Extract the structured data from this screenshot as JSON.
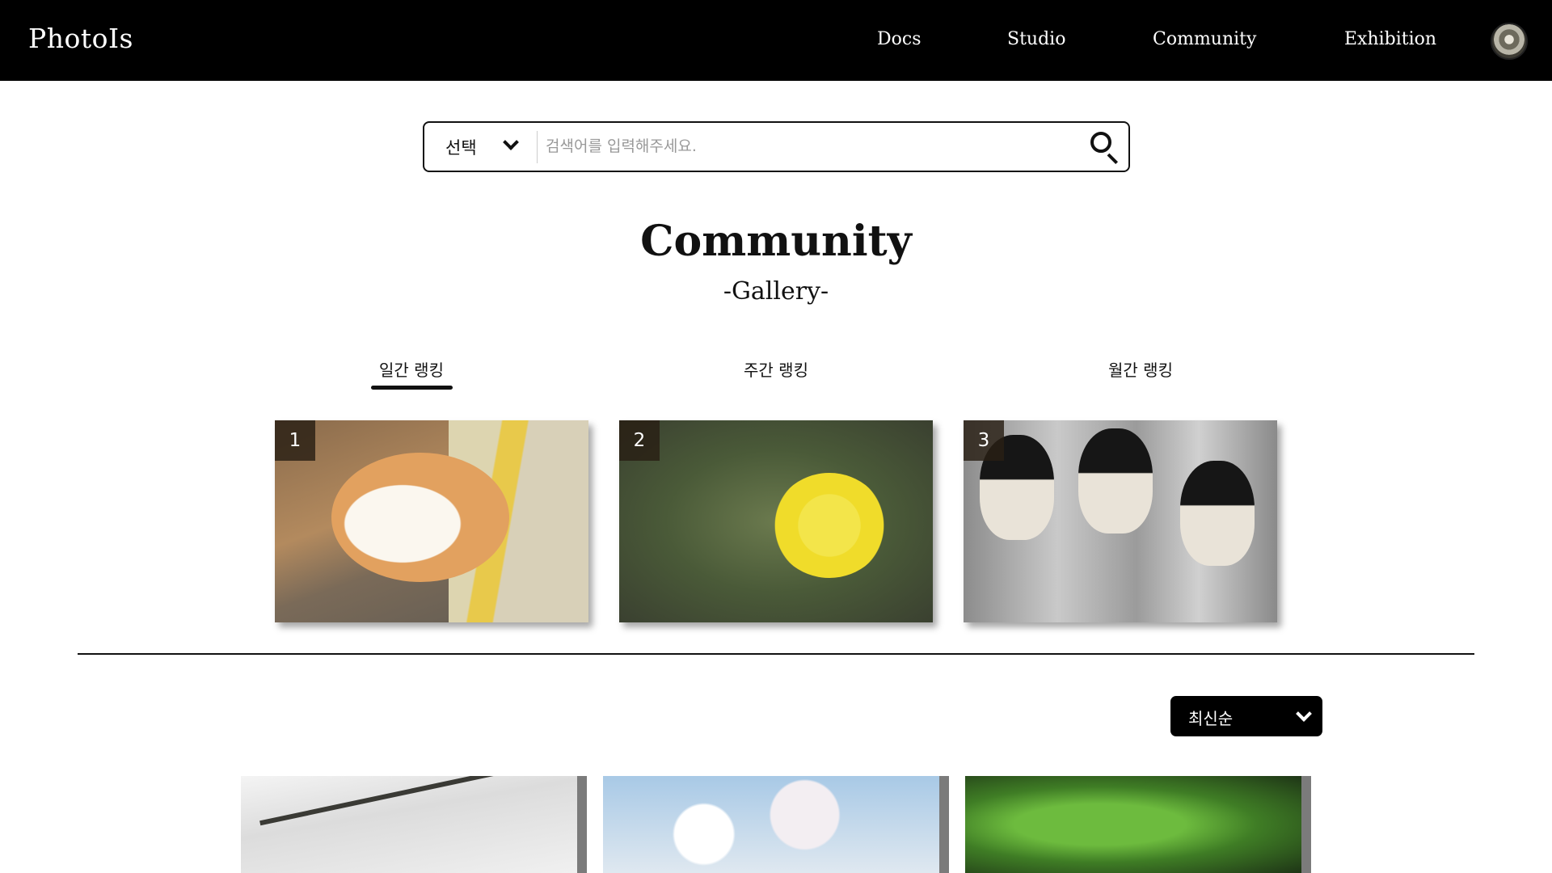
{
  "header": {
    "brand": "PhotoIs",
    "nav": [
      "Docs",
      "Studio",
      "Community",
      "Exhibition"
    ]
  },
  "search": {
    "select_label": "선택",
    "placeholder": "검색어를 입력해주세요."
  },
  "page": {
    "title": "Community",
    "subtitle": "-Gallery-"
  },
  "ranking_tabs": [
    "일간 랭킹",
    "주간 랭킹",
    "월간 랭킹"
  ],
  "active_tab": "일간 랭킹",
  "ranked_photos": [
    {
      "rank": "1",
      "subject": "sleeping orange and white cat in a box"
    },
    {
      "rank": "2",
      "subject": "yellow dandelion"
    },
    {
      "rank": "3",
      "subject": "mannequin heads with black wigs"
    }
  ],
  "sort": {
    "label": "최신순"
  },
  "gallery_photos": [
    {
      "subject": "bare tree branches against pale sky"
    },
    {
      "subject": "cherry blossoms against blue sky"
    },
    {
      "subject": "green leaves"
    }
  ],
  "colors": {
    "header_bg": "#000000",
    "accent": "#111111"
  }
}
